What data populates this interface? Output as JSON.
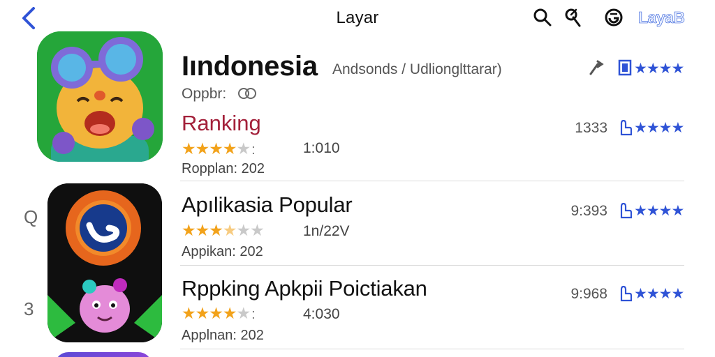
{
  "header": {
    "title": "Layar",
    "right_link": "LayaB",
    "icons": [
      "back-icon",
      "search-icon",
      "search-alt-icon",
      "refresh-icon"
    ]
  },
  "featured": {
    "title": "Iındonesia",
    "subtitle": "Andsonds / Udlionglttarar)",
    "opp_label": "Oppbr:",
    "section_label": "Ranking",
    "rating_stars": 4.5,
    "rating_value": "1:010",
    "sub_label": "Ropplan: 202",
    "right_count_1": "",
    "right_count_2": "1333",
    "right_stars": "★★★★"
  },
  "rows": [
    {
      "index": "Q",
      "title": "Apılikasia Popular",
      "rating_stars": 3.5,
      "rating_value": "1n/22V",
      "sub_label": "Appikan: 202",
      "right_count": "9:393",
      "right_stars": "★★★★"
    },
    {
      "index": "3",
      "title": "Rppking Apkpii Poictiakan",
      "rating_stars": 4,
      "rating_value": "4:030",
      "sub_label": "Applnan: 202",
      "right_count": "9:968",
      "right_stars": "★★★★"
    }
  ],
  "colors": {
    "accent_blue": "#2f53d6",
    "star_gold": "#f2a21a",
    "ranking_red": "#a3203a"
  }
}
